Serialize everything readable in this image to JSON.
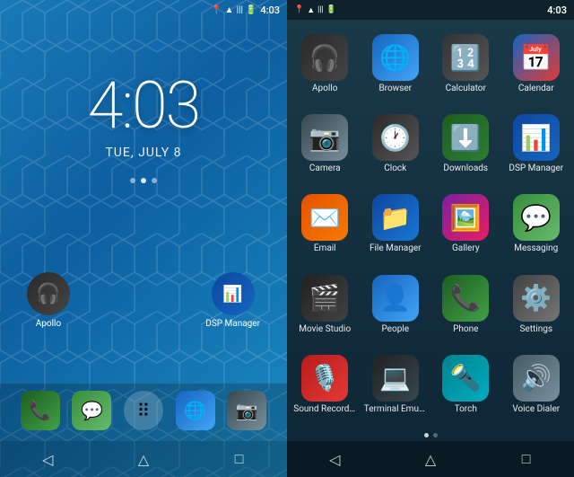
{
  "left": {
    "time": "4:03",
    "date": "TUE, JULY 8",
    "statusTime": "4:03",
    "appIcons": [
      {
        "name": "Apollo",
        "key": "apollo"
      },
      {
        "name": "DSP Manager",
        "key": "dsp"
      }
    ],
    "dockIcons": [
      "phone",
      "messaging",
      "launcher",
      "browser",
      "camera"
    ],
    "navBtns": [
      "◁",
      "△",
      "□"
    ]
  },
  "right": {
    "statusTime": "4:03",
    "apps": [
      {
        "label": "Apollo",
        "key": "apollo"
      },
      {
        "label": "Browser",
        "key": "browser"
      },
      {
        "label": "Calculator",
        "key": "calculator"
      },
      {
        "label": "Calendar",
        "key": "calendar"
      },
      {
        "label": "Camera",
        "key": "camera"
      },
      {
        "label": "Clock",
        "key": "clock"
      },
      {
        "label": "Downloads",
        "key": "downloads"
      },
      {
        "label": "DSP Manager",
        "key": "dsp"
      },
      {
        "label": "Email",
        "key": "email"
      },
      {
        "label": "File Manager",
        "key": "filemanager"
      },
      {
        "label": "Gallery",
        "key": "gallery"
      },
      {
        "label": "Messaging",
        "key": "messaging"
      },
      {
        "label": "Movie Studio",
        "key": "moviestudio"
      },
      {
        "label": "People",
        "key": "people"
      },
      {
        "label": "Phone",
        "key": "phone"
      },
      {
        "label": "Settings",
        "key": "settings"
      },
      {
        "label": "Sound Recorder",
        "key": "soundrec"
      },
      {
        "label": "Terminal Emulat.",
        "key": "terminal"
      },
      {
        "label": "Torch",
        "key": "torch"
      },
      {
        "label": "Voice Dialer",
        "key": "voicedialer"
      }
    ],
    "navBtns": [
      "◁",
      "△",
      "□"
    ]
  }
}
